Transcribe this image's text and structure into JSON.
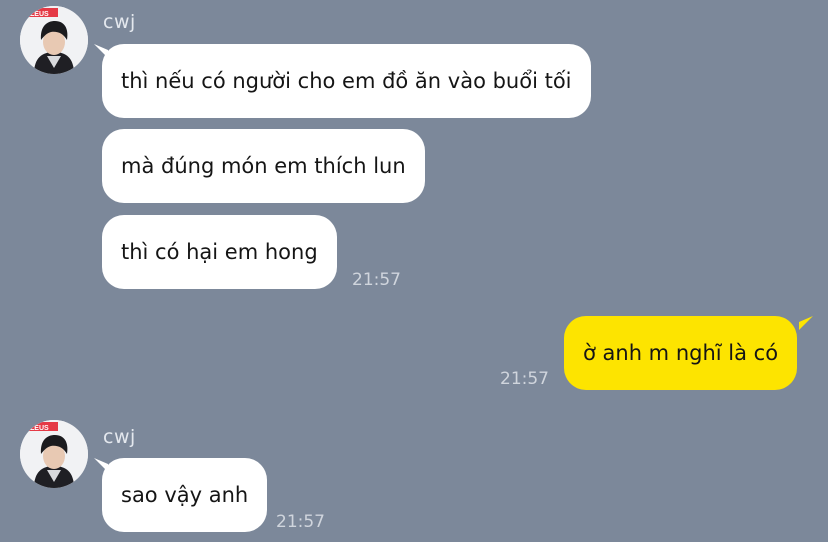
{
  "conversation": {
    "group1": {
      "sender": "cwj",
      "avatar_badge": "ZEUS",
      "messages": [
        "thì nếu có người cho em đồ ăn vào buổi tối",
        "mà đúng món em thích lun",
        "thì có hại em hong"
      ],
      "time": "21:57"
    },
    "mine": {
      "message": "ờ anh m nghĩ là có",
      "time": "21:57"
    },
    "group2": {
      "sender": "cwj",
      "avatar_badge": "ZEUS",
      "messages": [
        "sao vậy anh"
      ],
      "time": "21:57"
    }
  },
  "colors": {
    "background": "#7c889a",
    "incoming_bubble": "#ffffff",
    "outgoing_bubble": "#fde400",
    "text": "#151515"
  }
}
